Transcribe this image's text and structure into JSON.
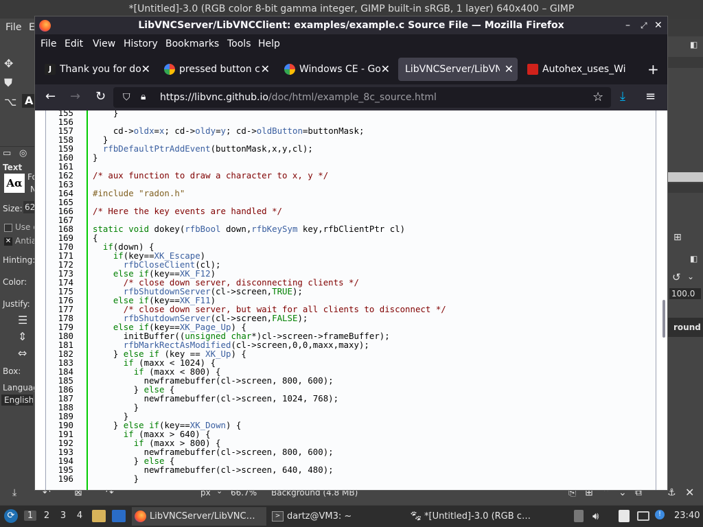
{
  "gimp": {
    "title": "*[Untitled]-3.0 (RGB color 8-bit gamma integer, GIMP built-in sRGB, 1 layer) 640x400 – GIMP",
    "menu": [
      "File",
      "E"
    ],
    "left_panel": {
      "text_label": "Text",
      "size_label": "Size:",
      "size_value": "62",
      "use_label": "Use e",
      "antialias_label": "Antia",
      "hinting_label": "Hinting:",
      "color_label": "Color:",
      "justify_label": "Justify:",
      "box_label": "Box:",
      "language_label": "Languag",
      "language_value": "English",
      "font_label": "Fo",
      "font_short": "N"
    },
    "right_panel": {
      "opacity_value": "100.0",
      "layer_name": "round"
    },
    "statusbar": {
      "unit": "px",
      "zoom": "66.7%",
      "layer_info": "Background (4.8 MB)"
    }
  },
  "taskbar": {
    "workspaces": [
      "1",
      "2",
      "3",
      "4"
    ],
    "tasks": [
      {
        "label": "LibVNCServer/LibVNC…",
        "icon": "firefox-icon"
      },
      {
        "label": "dartz@VM3: ~",
        "icon": "terminal-icon"
      },
      {
        "label": "*[Untitled]-3.0 (RGB c…",
        "icon": "gimp-icon"
      }
    ],
    "clock": "23:40"
  },
  "firefox": {
    "title": "LibVNCServer/LibVNCClient: examples/example.c Source File — Mozilla Firefox",
    "menu": [
      "File",
      "Edit",
      "View",
      "History",
      "Bookmarks",
      "Tools",
      "Help"
    ],
    "tabs": [
      {
        "label": "Thank you for dow",
        "favicon_color": "#222222",
        "active": false
      },
      {
        "label": "pressed button cli",
        "favicon_color": "#4285f4",
        "active": false
      },
      {
        "label": "Windows CE - Goo",
        "favicon_color": "#4285f4",
        "active": false
      },
      {
        "label": "LibVNCServer/LibVNC",
        "favicon_color": "#42414d",
        "active": true
      },
      {
        "label": "Autohex_uses_Wi",
        "favicon_color": "#d0221b",
        "active": false
      }
    ],
    "url_domain": "https://libvnc.github.io",
    "url_path": "/doc/html/example_8c_source.html"
  },
  "source_lines": [
    {
      "n": "155",
      "html": "    }"
    },
    {
      "n": "156",
      "html": ""
    },
    {
      "n": "157",
      "html": "    cd-&gt;<span class=\"id\">oldx</span>=<span class=\"id\">x</span>; cd-&gt;<span class=\"id\">oldy</span>=<span class=\"id\">y</span>; cd-&gt;<span class=\"id\">oldButton</span>=buttonMask;"
    },
    {
      "n": "158",
      "html": "  }"
    },
    {
      "n": "159",
      "html": "  <span class=\"id\">rfbDefaultPtrAddEvent</span>(buttonMask,x,y,cl);"
    },
    {
      "n": "160",
      "html": "}"
    },
    {
      "n": "161",
      "html": ""
    },
    {
      "n": "162",
      "html": "<span class=\"cm\">/* aux function to draw a character to x, y */</span>"
    },
    {
      "n": "163",
      "html": ""
    },
    {
      "n": "164",
      "html": "<span class=\"pp\">#include \"radon.h\"</span>"
    },
    {
      "n": "165",
      "html": ""
    },
    {
      "n": "166",
      "html": "<span class=\"cm\">/* Here the key events are handled */</span>"
    },
    {
      "n": "167",
      "html": ""
    },
    {
      "n": "168",
      "html": "<span class=\"kw\">static</span> <span class=\"kw\">void</span> dokey(<span class=\"id\">rfbBool</span> down,<span class=\"id\">rfbKeySym</span> key,rfbClientPtr cl)"
    },
    {
      "n": "169",
      "html": "{"
    },
    {
      "n": "170",
      "html": "  <span class=\"kw\">if</span>(down) {"
    },
    {
      "n": "171",
      "html": "    <span class=\"kw\">if</span>(key==<span class=\"id\">XK_Escape</span>)"
    },
    {
      "n": "172",
      "html": "      <span class=\"id\">rfbCloseClient</span>(cl);"
    },
    {
      "n": "173",
      "html": "    <span class=\"kw\">else</span> <span class=\"kw\">if</span>(key==<span class=\"id\">XK_F12</span>)"
    },
    {
      "n": "174",
      "html": "      <span class=\"cm\">/* close down server, disconnecting clients */</span>"
    },
    {
      "n": "175",
      "html": "      <span class=\"id\">rfbShutdownServer</span>(cl-&gt;screen,<span class=\"kw\">TRUE</span>);"
    },
    {
      "n": "176",
      "html": "    <span class=\"kw\">else</span> <span class=\"kw\">if</span>(key==<span class=\"id\">XK_F11</span>)"
    },
    {
      "n": "177",
      "html": "      <span class=\"cm\">/* close down server, but wait for all clients to disconnect */</span>"
    },
    {
      "n": "178",
      "html": "      <span class=\"id\">rfbShutdownServer</span>(cl-&gt;screen,<span class=\"kw\">FALSE</span>);"
    },
    {
      "n": "179",
      "html": "    <span class=\"kw\">else</span> <span class=\"kw\">if</span>(key==<span class=\"id\">XK_Page_Up</span>) {"
    },
    {
      "n": "180",
      "html": "      initBuffer((<span class=\"kw\">unsigned</span> <span class=\"kw\">char</span>*)cl-&gt;screen-&gt;frameBuffer);"
    },
    {
      "n": "181",
      "html": "      <span class=\"id\">rfbMarkRectAsModified</span>(cl-&gt;screen,0,0,maxx,maxy);"
    },
    {
      "n": "182",
      "html": "    } <span class=\"kw\">else</span> <span class=\"kw\">if</span> (key == <span class=\"id\">XK_Up</span>) {"
    },
    {
      "n": "183",
      "html": "      <span class=\"kw\">if</span> (maxx &lt; 1024) {"
    },
    {
      "n": "184",
      "html": "        <span class=\"kw\">if</span> (maxx &lt; 800) {"
    },
    {
      "n": "185",
      "html": "          newframebuffer(cl-&gt;screen, 800, 600);"
    },
    {
      "n": "186",
      "html": "        } <span class=\"kw\">else</span> {"
    },
    {
      "n": "187",
      "html": "          newframebuffer(cl-&gt;screen, 1024, 768);"
    },
    {
      "n": "188",
      "html": "        }"
    },
    {
      "n": "189",
      "html": "      }"
    },
    {
      "n": "190",
      "html": "    } <span class=\"kw\">else</span> <span class=\"kw\">if</span>(key==<span class=\"id\">XK_Down</span>) {"
    },
    {
      "n": "191",
      "html": "      <span class=\"kw\">if</span> (maxx &gt; 640) {"
    },
    {
      "n": "192",
      "html": "        <span class=\"kw\">if</span> (maxx &gt; 800) {"
    },
    {
      "n": "193",
      "html": "          newframebuffer(cl-&gt;screen, 800, 600);"
    },
    {
      "n": "194",
      "html": "        } <span class=\"kw\">else</span> {"
    },
    {
      "n": "195",
      "html": "          newframebuffer(cl-&gt;screen, 640, 480);"
    },
    {
      "n": "196",
      "html": "        }"
    }
  ]
}
